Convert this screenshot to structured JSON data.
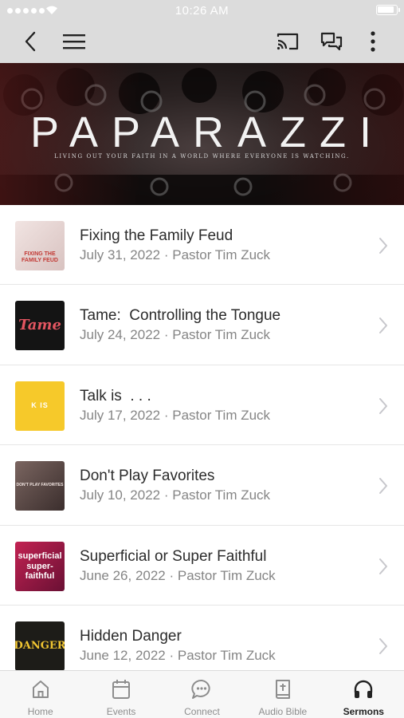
{
  "status_bar": {
    "time": "10:26 AM"
  },
  "banner": {
    "title": "PAPARAZZI",
    "subtitle": "LIVING OUT YOUR FAITH IN A WORLD WHERE EVERYONE IS WATCHING."
  },
  "sermons": [
    {
      "title": "Fixing the Family Feud",
      "subtitle": "July 31, 2022 · Pastor Tim Zuck",
      "thumb_text": "FIXING THE FAMILY FEUD"
    },
    {
      "title": "Tame:  Controlling the Tongue",
      "subtitle": "July 24, 2022 · Pastor Tim Zuck",
      "thumb_text": "Tame"
    },
    {
      "title": "Talk is  . . .",
      "subtitle": "July 17, 2022 · Pastor Tim Zuck",
      "thumb_text": "K IS"
    },
    {
      "title": "Don't Play Favorites",
      "subtitle": "July 10, 2022 · Pastor Tim Zuck",
      "thumb_text": "DON'T PLAY FAVORITES"
    },
    {
      "title": "Superficial or Super Faithful",
      "subtitle": "June 26, 2022 · Pastor Tim Zuck",
      "thumb_text": "superficial super-faithful"
    },
    {
      "title": "Hidden Danger",
      "subtitle": "June 12, 2022 · Pastor Tim Zuck",
      "thumb_text": "DANGER"
    }
  ],
  "tabs": [
    {
      "label": "Home",
      "icon": "home-icon"
    },
    {
      "label": "Events",
      "icon": "calendar-icon"
    },
    {
      "label": "Connect",
      "icon": "chat-bubble-icon"
    },
    {
      "label": "Audio Bible",
      "icon": "bible-icon"
    },
    {
      "label": "Sermons",
      "icon": "headphones-icon",
      "active": true
    }
  ],
  "colors": {
    "header_bg": "#dcdcdc",
    "tab_inactive": "#8d8d8d",
    "tab_active": "#222222",
    "chevron": "#c7c7cc"
  }
}
